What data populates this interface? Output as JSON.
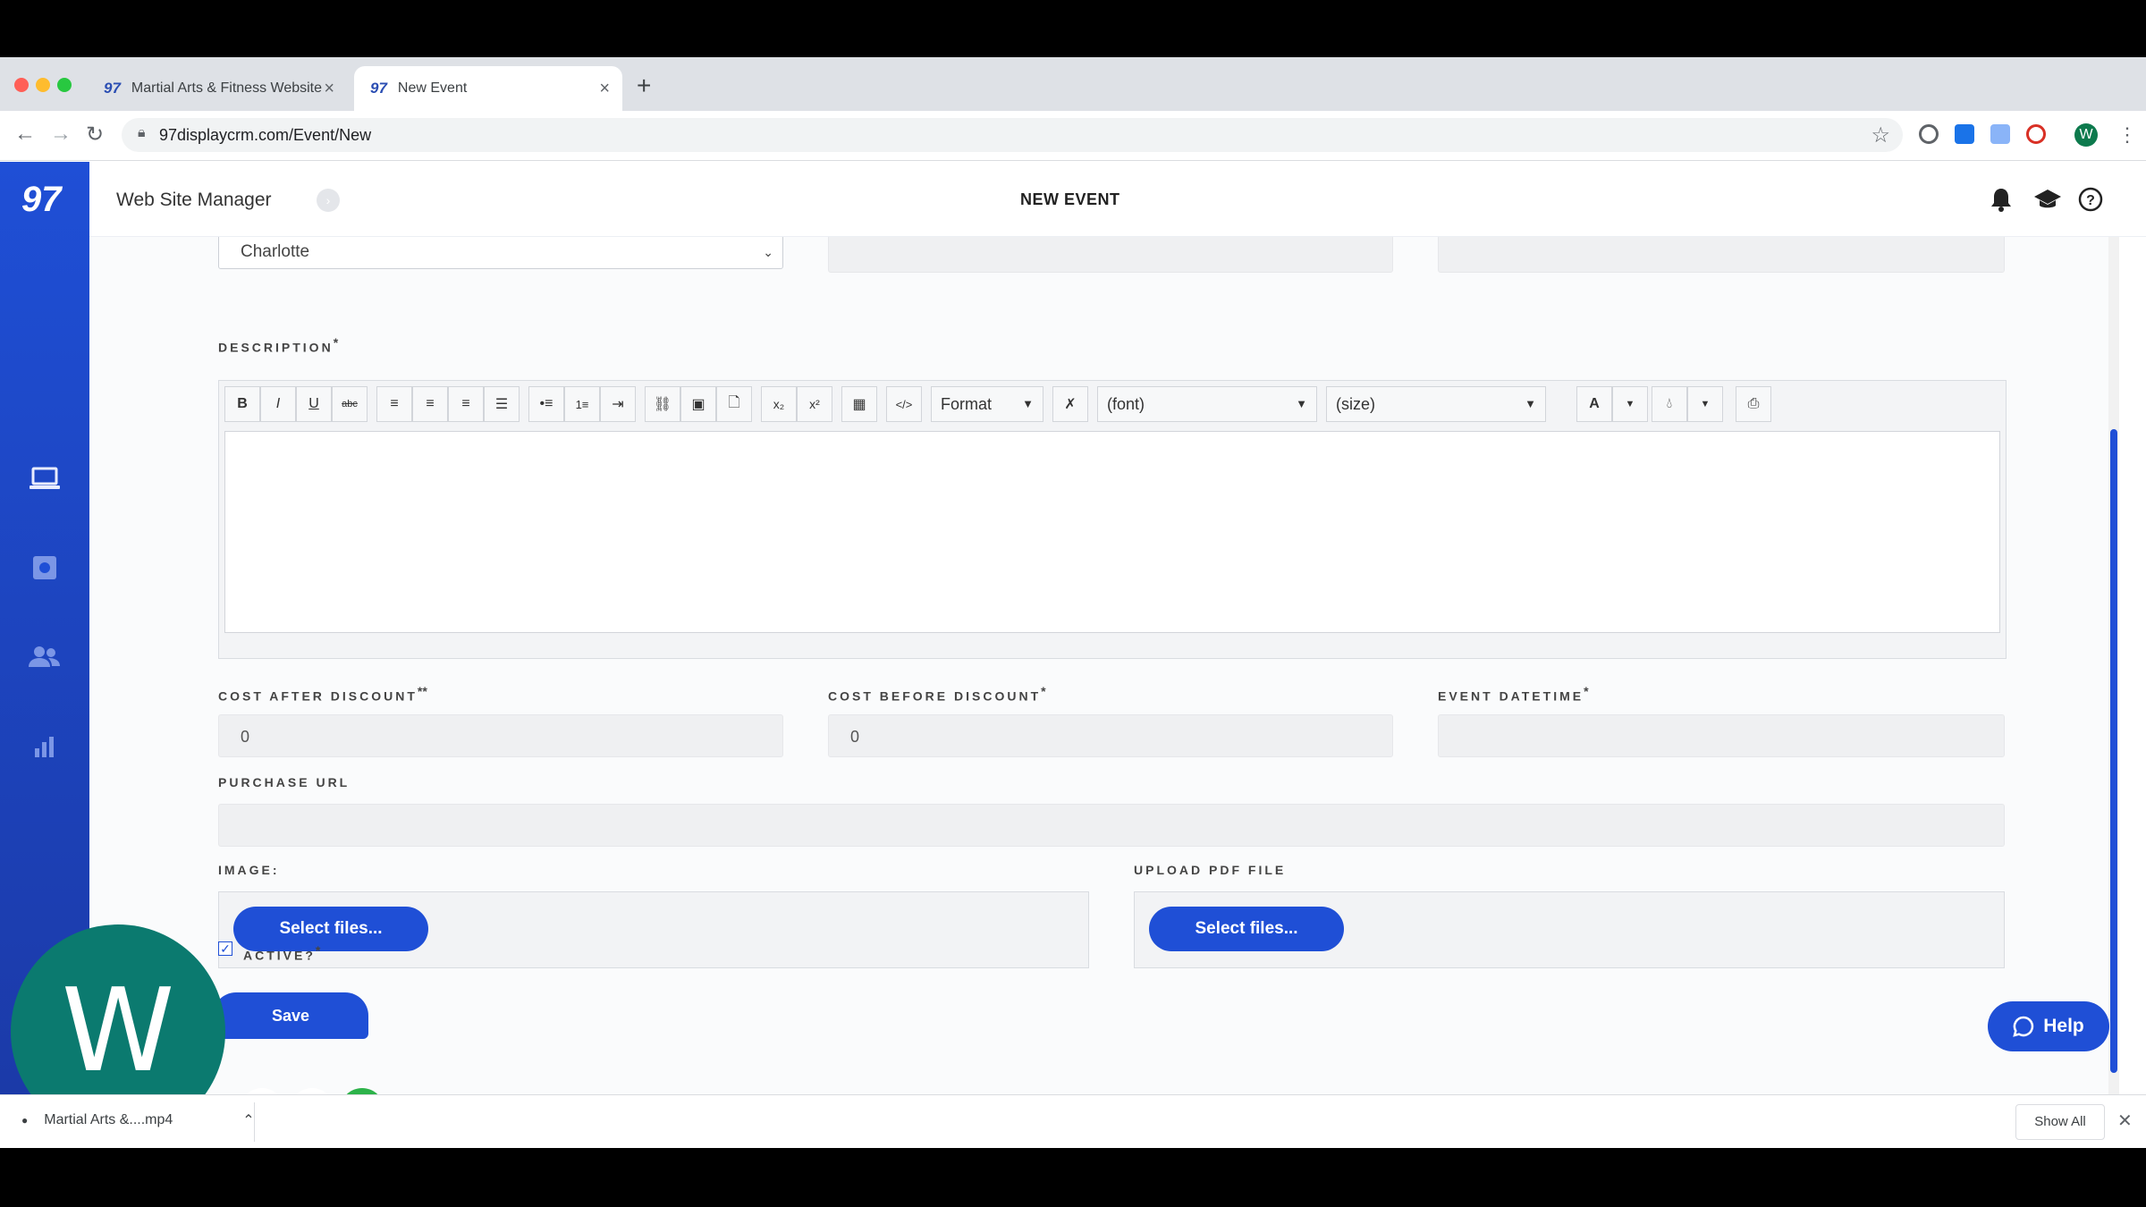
{
  "browser": {
    "tabs": [
      {
        "label": "Martial Arts & Fitness Website",
        "active": false
      },
      {
        "label": "New Event",
        "active": true
      }
    ],
    "url": "97displaycrm.com/Event/New",
    "profile_initial": "W"
  },
  "app": {
    "logo": "97",
    "brand": "Web Site Manager",
    "page_title": "NEW EVENT",
    "sidebar_icons": [
      "laptop-icon",
      "settings-box-icon",
      "users-icon",
      "bar-chart-icon"
    ],
    "header_icons": [
      "bell-icon",
      "graduation-cap-icon",
      "help-circle-icon"
    ],
    "accent_color": "#1f4fd6"
  },
  "form": {
    "location_select": {
      "value": "Charlotte"
    },
    "description": {
      "label": "DESCRIPTION",
      "required_mark": "*",
      "format_dropdown": "Format",
      "font_dropdown": "(font)",
      "size_dropdown": "(size)",
      "font_color_label": "A"
    },
    "cost_after_discount": {
      "label": "COST AFTER DISCOUNT",
      "required_mark": "**",
      "value": "0"
    },
    "cost_before_discount": {
      "label": "COST BEFORE DISCOUNT",
      "required_mark": "*",
      "value": "0"
    },
    "event_datetime": {
      "label": "EVENT DATETIME",
      "required_mark": "*",
      "value": ""
    },
    "purchase_url": {
      "label": "PURCHASE URL",
      "value": ""
    },
    "image": {
      "label": "IMAGE:",
      "button": "Select files..."
    },
    "upload_pdf": {
      "label": "UPLOAD PDF FILE",
      "button": "Select files..."
    },
    "active": {
      "label": "ACTIVE?",
      "required_mark": "*",
      "checked": true
    },
    "save_button": "Save"
  },
  "help_button": "Help",
  "recorder": {
    "avatar_letter": "W",
    "more": "···"
  },
  "download_bar": {
    "file": "Martial Arts &....mp4",
    "show_all": "Show All"
  }
}
